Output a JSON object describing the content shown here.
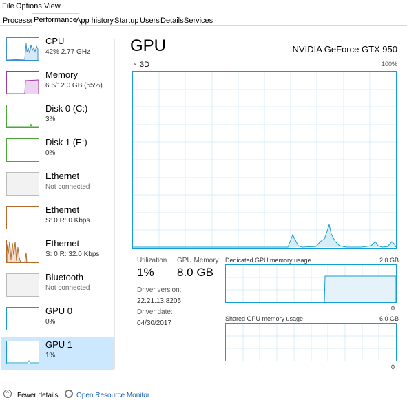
{
  "menu": {
    "file": "File",
    "options": "Options",
    "view": "View"
  },
  "tabs": [
    "Processes",
    "Performance",
    "App history",
    "Startup",
    "Users",
    "Details",
    "Services"
  ],
  "sidebar": {
    "items": [
      {
        "name": "CPU",
        "sub": "42%  2.77 GHz",
        "color": "#3a8fd0"
      },
      {
        "name": "Memory",
        "sub": "6.6/12.0 GB (55%)",
        "color": "#9b3aa0"
      },
      {
        "name": "Disk 0 (C:)",
        "sub": "3%",
        "color": "#4aa83a"
      },
      {
        "name": "Disk 1 (E:)",
        "sub": "0%",
        "color": "#4aa83a"
      },
      {
        "name": "Ethernet",
        "sub": "Not connected",
        "color": "#aaaaaa"
      },
      {
        "name": "Ethernet",
        "sub": "S: 0  R: 0 Kbps",
        "color": "#b06a2a"
      },
      {
        "name": "Ethernet",
        "sub": "S: 0  R: 32.0 Kbps",
        "color": "#b06a2a"
      },
      {
        "name": "Bluetooth",
        "sub": "Not connected",
        "color": "#aaaaaa"
      },
      {
        "name": "GPU 0",
        "sub": "0%",
        "color": "#139fd1"
      },
      {
        "name": "GPU 1",
        "sub": "1%",
        "color": "#139fd1"
      }
    ]
  },
  "main": {
    "title": "GPU",
    "device": "NVIDIA GeForce GTX 950",
    "engine": "3D",
    "max": "100%",
    "utilization_label": "Utilization",
    "utilization_value": "1%",
    "gpu_memory_label": "GPU Memory",
    "gpu_memory_value": "8.0 GB",
    "driver_version_label": "Driver version:",
    "driver_version": "22.21.13.8205",
    "driver_date_label": "Driver date:",
    "driver_date": "04/30/2017",
    "dedicated_label": "Dedicated GPU memory usage",
    "dedicated_max": "2.0 GB",
    "dedicated_min": "0",
    "shared_label": "Shared GPU memory usage",
    "shared_max": "6.0 GB",
    "shared_min": "0"
  },
  "footer": {
    "fewer": "Fewer details",
    "resource_monitor": "Open Resource Monitor"
  },
  "colors": {
    "accent": "#139fd1",
    "selected": "#cce8ff",
    "link": "#1a5fb4"
  }
}
